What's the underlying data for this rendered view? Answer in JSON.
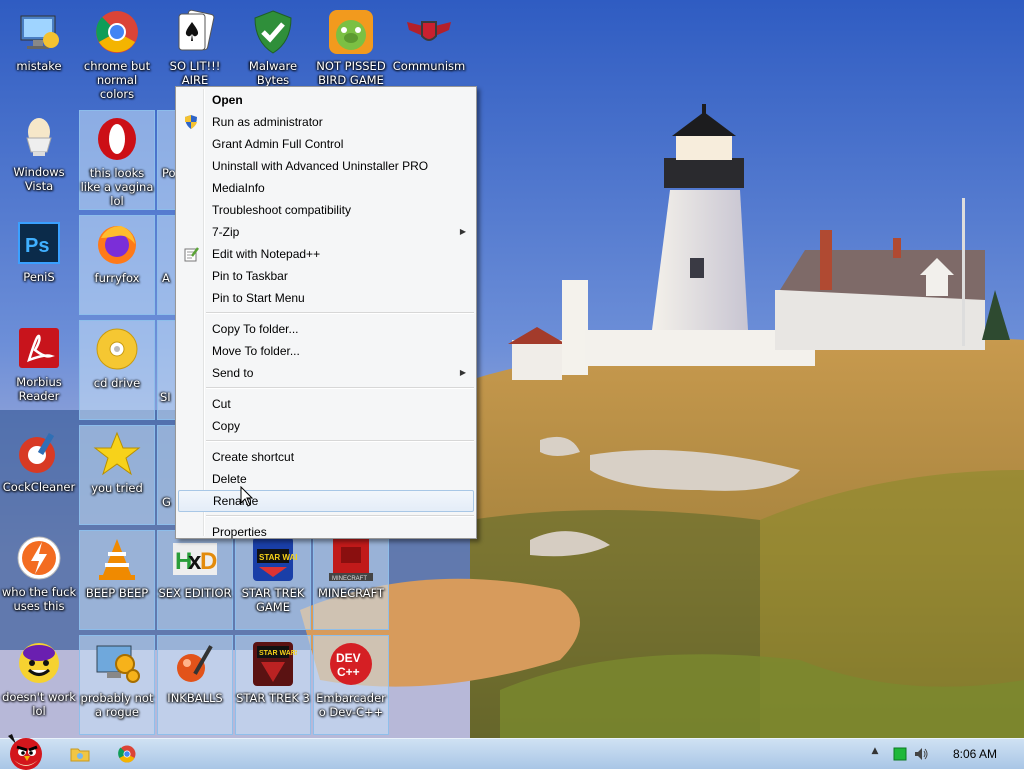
{
  "desktop": {
    "icons": [
      {
        "label": "mistake",
        "icon": "computer-tool-icon"
      },
      {
        "label": "chrome but normal colors",
        "icon": "chrome-icon"
      },
      {
        "label": "SO LIT!!! AIRE",
        "icon": "solitaire-icon"
      },
      {
        "label": "Malware Bytes",
        "icon": "shield-check-icon"
      },
      {
        "label": "NOT PISSED BIRD GAME",
        "icon": "bad-piggies-icon"
      },
      {
        "label": "Communism",
        "icon": "winged-shield-icon"
      },
      {
        "label": "Windows Vista",
        "icon": "egg-cup-icon"
      },
      {
        "label": "this looks like a vagina lol",
        "icon": "opera-icon"
      },
      {
        "label": "Po",
        "icon": "partial-icon"
      },
      {
        "label": "PeniS",
        "icon": "photoshop-icon"
      },
      {
        "label": "furryfox",
        "icon": "firefox-icon"
      },
      {
        "label": "A",
        "icon": "partial-icon"
      },
      {
        "label": "Morbius Reader",
        "icon": "pdf-reader-icon"
      },
      {
        "label": "cd drive",
        "icon": "cd-icon"
      },
      {
        "label": "SI",
        "icon": "partial-icon"
      },
      {
        "label": "CockCleaner",
        "icon": "ccleaner-icon"
      },
      {
        "label": "you tried",
        "icon": "star-icon"
      },
      {
        "label": "G",
        "icon": "partial-icon"
      },
      {
        "label": "who the fuck uses this",
        "icon": "lightning-icon"
      },
      {
        "label": "BEEP BEEP",
        "icon": "vlc-icon"
      },
      {
        "label": "SEX EDITIOR",
        "icon": "hex-editor-icon"
      },
      {
        "label": "STAR TREK GAME",
        "icon": "star-wars-icon"
      },
      {
        "label": "MINECRAFT",
        "icon": "minecraft-icon"
      },
      {
        "label": "doesn't work lol",
        "icon": "yahoo-icon"
      },
      {
        "label": "probably not a rogue",
        "icon": "monitor-gears-icon"
      },
      {
        "label": "INKBALLS",
        "icon": "inkball-icon"
      },
      {
        "label": "STAR TREK 3",
        "icon": "star-wars-icon"
      },
      {
        "label": "Embarcadero Dev-C++",
        "icon": "devcpp-icon"
      }
    ]
  },
  "context_menu": {
    "items": [
      {
        "label": "Open",
        "bold": true
      },
      {
        "label": "Run as administrator",
        "icon": "uac-shield-icon"
      },
      {
        "label": "Grant Admin Full Control"
      },
      {
        "label": "Uninstall with Advanced Uninstaller PRO"
      },
      {
        "label": "MediaInfo"
      },
      {
        "label": "Troubleshoot compatibility"
      },
      {
        "label": "7-Zip",
        "submenu": true
      },
      {
        "label": "Edit with Notepad++",
        "icon": "notepad-plus-icon"
      },
      {
        "label": "Pin to Taskbar"
      },
      {
        "label": "Pin to Start Menu"
      },
      {
        "separator": true
      },
      {
        "label": "Copy To folder..."
      },
      {
        "label": "Move To folder..."
      },
      {
        "label": "Send to",
        "submenu": true
      },
      {
        "separator": true
      },
      {
        "label": "Cut"
      },
      {
        "label": "Copy"
      },
      {
        "separator": true
      },
      {
        "label": "Create shortcut"
      },
      {
        "label": "Delete"
      },
      {
        "label": "Rename",
        "hover": true
      },
      {
        "separator": true
      },
      {
        "label": "Properties"
      }
    ],
    "submenu_arrow": "▶"
  },
  "taskbar": {
    "start_icon": "angry-bird-start-icon",
    "pinned": [
      {
        "name": "explorer-icon"
      },
      {
        "name": "chrome-icon"
      }
    ],
    "tray": {
      "show_hidden": "▲",
      "icons": [
        "network-icon",
        "volume-icon"
      ],
      "clock": "8:06 AM"
    }
  }
}
